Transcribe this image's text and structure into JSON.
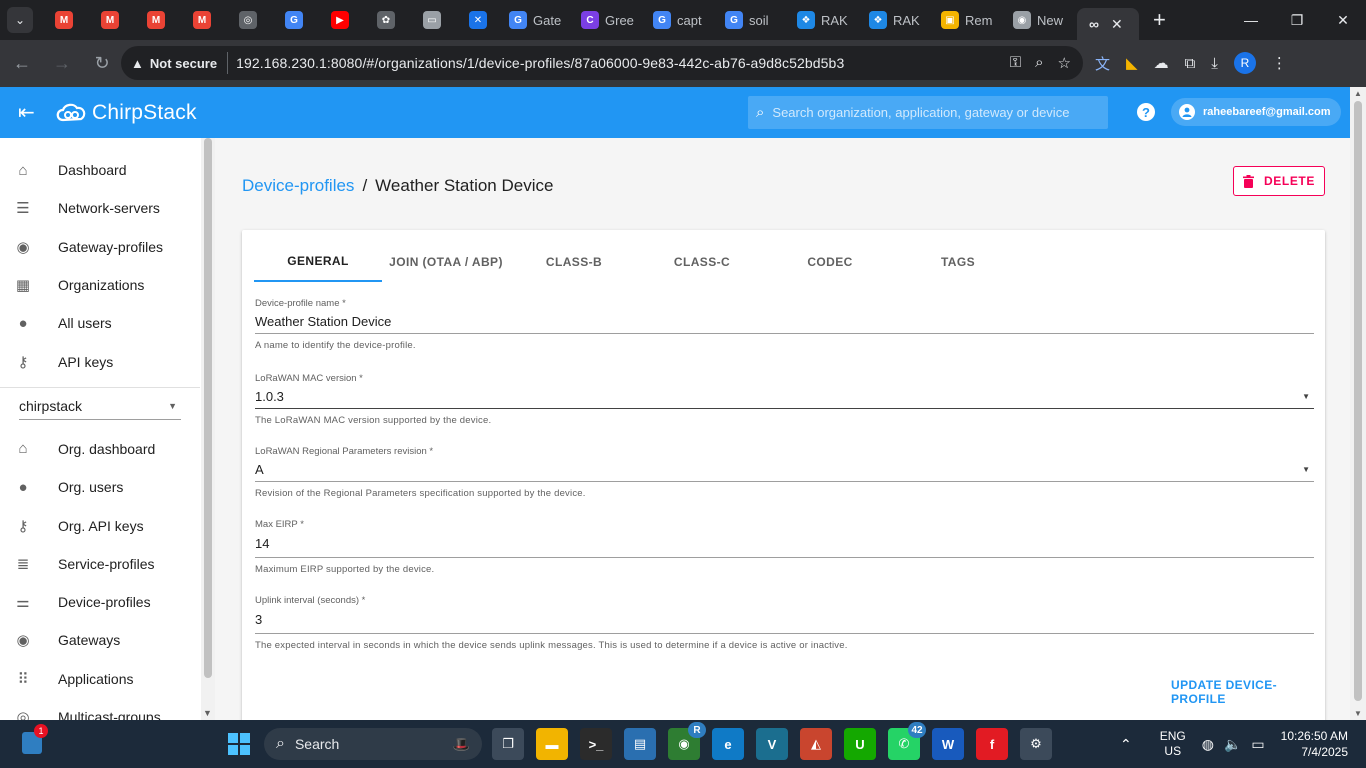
{
  "browser": {
    "tabs": [
      {
        "icon": "gmail-icon",
        "color": "#ea4335",
        "glyph": "M"
      },
      {
        "icon": "gmail-icon",
        "color": "#ea4335",
        "glyph": "M"
      },
      {
        "icon": "gmail-icon",
        "color": "#ea4335",
        "glyph": "M"
      },
      {
        "icon": "gmail-icon",
        "color": "#ea4335",
        "glyph": "M"
      },
      {
        "icon": "openai-icon",
        "color": "#5f6368",
        "glyph": "◎"
      },
      {
        "icon": "translate-icon",
        "color": "#4285f4",
        "glyph": "G"
      },
      {
        "icon": "youtube-icon",
        "color": "#ff0000",
        "glyph": "▶"
      },
      {
        "icon": "copilot-icon",
        "color": "#5f6368",
        "glyph": "✿"
      },
      {
        "icon": "folder-icon",
        "color": "#9aa0a6",
        "glyph": "▭"
      },
      {
        "icon": "butterfly-icon",
        "color": "#1a73e8",
        "glyph": "✕"
      }
    ],
    "titled_tabs": [
      {
        "icon": "google-icon",
        "label": "Gate",
        "color": "#4285f4",
        "glyph": "G"
      },
      {
        "icon": "canva-icon",
        "label": "Gree",
        "color": "#7b3fe4",
        "glyph": "C"
      },
      {
        "icon": "google-icon",
        "label": "capt",
        "color": "#4285f4",
        "glyph": "G"
      },
      {
        "icon": "google-icon",
        "label": "soil",
        "color": "#4285f4",
        "glyph": "G"
      },
      {
        "icon": "rak-icon",
        "label": "RAK",
        "color": "#1e88e5",
        "glyph": "❖"
      },
      {
        "icon": "rak-icon",
        "label": "RAK",
        "color": "#1e88e5",
        "glyph": "❖"
      },
      {
        "icon": "slides-icon",
        "label": "Rem",
        "color": "#f4b400",
        "glyph": "▣"
      },
      {
        "icon": "chrome-icon",
        "label": "New",
        "color": "#9aa0a6",
        "glyph": "◉"
      }
    ],
    "url": "192.168.230.1:8080/#/organizations/1/device-profiles/87a06000-9e83-442c-ab76-a9d8c52bd5b3",
    "security_label": "Not secure",
    "profile_initial": "R"
  },
  "app": {
    "brand": "ChirpStack",
    "search_placeholder": "Search organization, application, gateway or device",
    "help_glyph": "?",
    "user_email": "raheebareef@gmail.com"
  },
  "sidebar": {
    "global_items": [
      {
        "label": "Dashboard",
        "icon": "home-icon",
        "glyph": "⌂"
      },
      {
        "label": "Network-servers",
        "icon": "server-icon",
        "glyph": "☰"
      },
      {
        "label": "Gateway-profiles",
        "icon": "antenna-icon",
        "glyph": "◉"
      },
      {
        "label": "Organizations",
        "icon": "building-icon",
        "glyph": "▦"
      },
      {
        "label": "All users",
        "icon": "person-icon",
        "glyph": "●"
      },
      {
        "label": "API keys",
        "icon": "key-icon",
        "glyph": "⚷"
      }
    ],
    "org_select": "chirpstack",
    "org_items": [
      {
        "label": "Org. dashboard",
        "icon": "home-icon",
        "glyph": "⌂"
      },
      {
        "label": "Org. users",
        "icon": "person-icon",
        "glyph": "●"
      },
      {
        "label": "Org. API keys",
        "icon": "key-icon",
        "glyph": "⚷"
      },
      {
        "label": "Service-profiles",
        "icon": "account-list-icon",
        "glyph": "≣"
      },
      {
        "label": "Device-profiles",
        "icon": "tune-icon",
        "glyph": "⚌"
      },
      {
        "label": "Gateways",
        "icon": "antenna-icon",
        "glyph": "◉"
      },
      {
        "label": "Applications",
        "icon": "apps-icon",
        "glyph": "⠿"
      },
      {
        "label": "Multicast-groups",
        "icon": "group-icon",
        "glyph": "◎"
      }
    ]
  },
  "page": {
    "breadcrumb_link": "Device-profiles",
    "breadcrumb_sep": "/",
    "title": "Weather Station Device",
    "delete_label": "DELETE",
    "tabs": [
      "GENERAL",
      "JOIN (OTAA / ABP)",
      "CLASS-B",
      "CLASS-C",
      "CODEC",
      "TAGS"
    ],
    "fields": {
      "name": {
        "label": "Device-profile name *",
        "value": "Weather Station Device",
        "help": "A name to identify the device-profile."
      },
      "mac": {
        "label": "LoRaWAN MAC version *",
        "value": "1.0.3",
        "help": "The LoRaWAN MAC version supported by the device."
      },
      "regional": {
        "label": "LoRaWAN Regional Parameters revision *",
        "value": "A",
        "help": "Revision of the Regional Parameters specification supported by the device."
      },
      "eirp": {
        "label": "Max EIRP *",
        "value": "14",
        "help": "Maximum EIRP supported by the device."
      },
      "uplink": {
        "label": "Uplink interval (seconds) *",
        "value": "3",
        "help": "The expected interval in seconds in which the device sends uplink messages. This is used to determine if a device is active or inactive."
      }
    },
    "update_label": "UPDATE DEVICE-PROFILE"
  },
  "taskbar": {
    "widget_badge": "1",
    "search_label": "Search",
    "apps": [
      {
        "icon": "task-view-icon",
        "color": "#3c4a5a",
        "glyph": "❐"
      },
      {
        "icon": "file-explorer-icon",
        "color": "#f2b400",
        "glyph": "▬"
      },
      {
        "icon": "terminal-icon",
        "color": "#2b2b2b",
        "glyph": ">_"
      },
      {
        "icon": "rdp-icon",
        "color": "#2a6fb0",
        "glyph": "▤"
      },
      {
        "icon": "chrome-icon",
        "color": "#2e7d32",
        "glyph": "◉"
      },
      {
        "icon": "edge-icon",
        "color": "#0f7ac6",
        "glyph": "e"
      },
      {
        "icon": "vscode-icon",
        "color": "#1b6e8f",
        "glyph": "V"
      },
      {
        "icon": "matlab-icon",
        "color": "#c9452e",
        "glyph": "◭"
      },
      {
        "icon": "upwork-icon",
        "color": "#14a800",
        "glyph": "U"
      },
      {
        "icon": "whatsapp-icon",
        "color": "#25d366",
        "glyph": "✆"
      },
      {
        "icon": "word-icon",
        "color": "#185abd",
        "glyph": "W"
      },
      {
        "icon": "foxit-icon",
        "color": "#e21b23",
        "glyph": "f"
      },
      {
        "icon": "settings-icon",
        "color": "#3c4a5a",
        "glyph": "⚙"
      }
    ],
    "whatsapp_badge": "42",
    "chrome_badge": "R",
    "lang_top": "ENG",
    "lang_bottom": "US",
    "time": "10:26:50 AM",
    "date": "7/4/2025"
  }
}
